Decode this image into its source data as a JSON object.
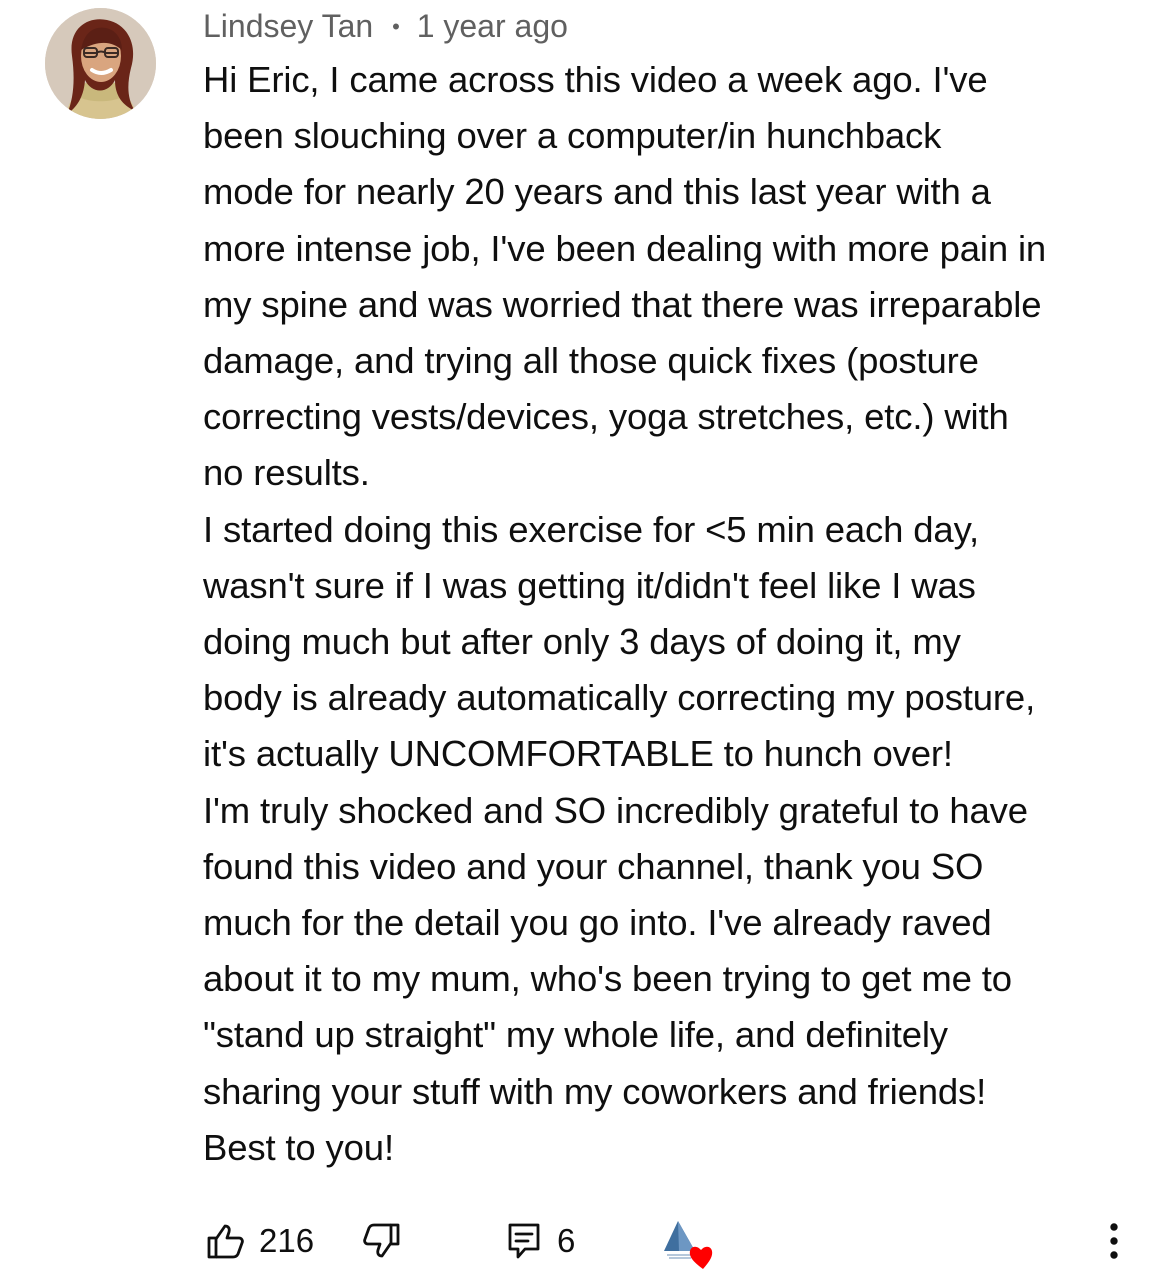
{
  "comment": {
    "author": "Lindsey Tan",
    "separator": "•",
    "timestamp": "1 year ago",
    "paragraphs": [
      [
        "Hi Eric, I came across this video a week ago. I've",
        "been slouching over a computer/in hunchback",
        "mode for nearly 20 years and this last year with a",
        "more intense job, I've been dealing with more pain in",
        "my spine and was worried that there was irreparable",
        "damage, and trying all those quick fixes (posture",
        "correcting vests/devices, yoga stretches, etc.) with",
        "no results."
      ],
      [
        "I started doing this exercise for <5 min each day,",
        "wasn't sure if I was getting it/didn't feel like I was",
        "doing much but after only 3 days of doing it, my",
        "body is already automatically correcting my posture,",
        "it's actually UNCOMFORTABLE to hunch over!"
      ],
      [
        "I'm truly shocked and SO incredibly grateful to have",
        "found this video and your channel, thank you SO",
        "much for the detail you go into. I've already raved",
        "about it to my mum, who's been trying to get me to",
        "\"stand up straight\" my whole life, and definitely",
        "sharing your stuff with my coworkers and friends!",
        "Best to you!"
      ]
    ]
  },
  "actions": {
    "like_icon": "thumbs-up-icon",
    "like_count": "216",
    "dislike_icon": "thumbs-down-icon",
    "reply_icon": "reply-comment-icon",
    "reply_count": "6",
    "creator_heart_icon": "creator-heart-icon",
    "more_icon": "more-vertical-icon"
  },
  "colors": {
    "text": "#0f0f0f",
    "meta": "#606060",
    "heart": "#ff0000",
    "channel_logo": "#3f6f9f",
    "background": "#ffffff"
  }
}
